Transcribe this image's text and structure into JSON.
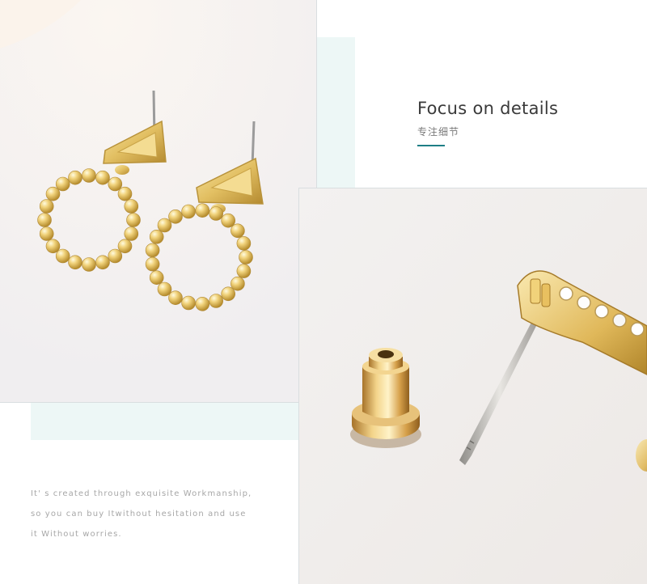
{
  "heading": {
    "title": "Focus on details",
    "subtitle": "专注细节",
    "accent_color": "#1f7f86"
  },
  "description": {
    "lines": [
      "It' s created through exquisite Workmanship,",
      "so you can buy Itwithout hesitation and use",
      "it Without worries."
    ]
  },
  "decor": {
    "mint_color": "#edf7f6"
  }
}
